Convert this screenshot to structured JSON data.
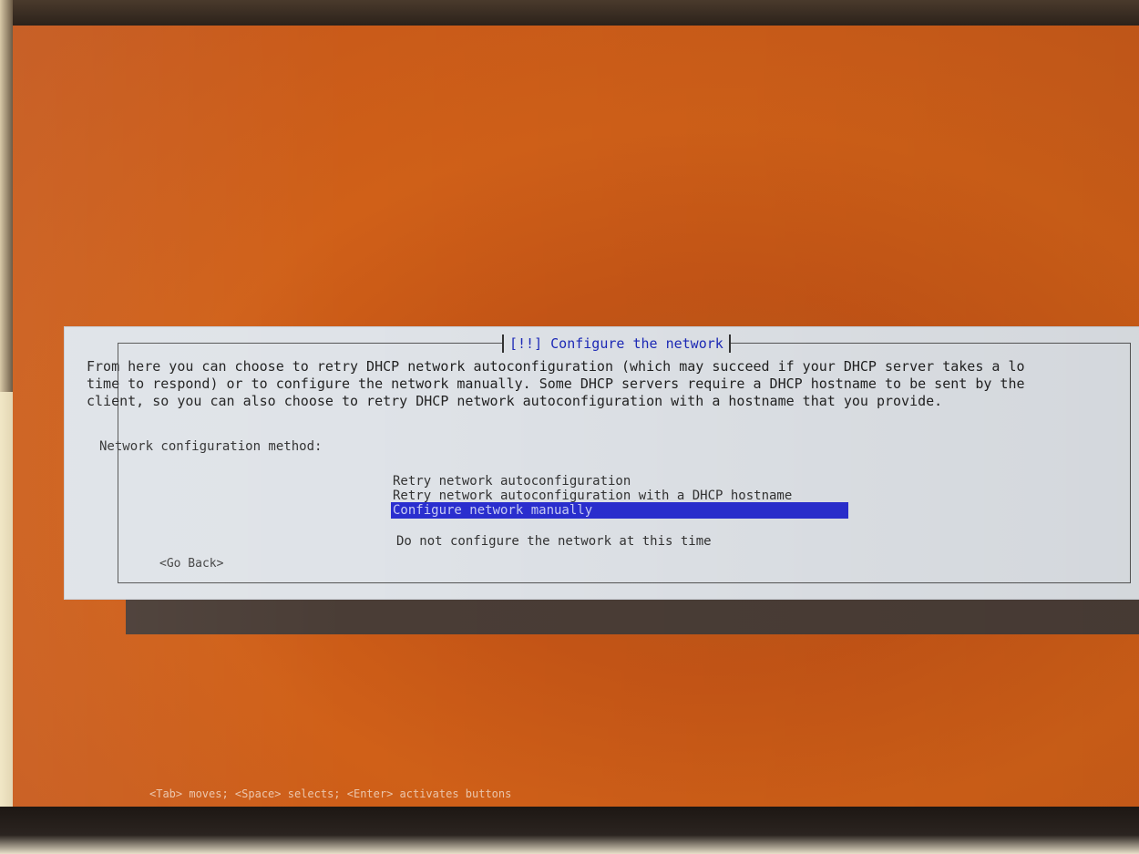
{
  "dialog": {
    "title": "[!!] Configure the network",
    "body_lines": [
      "From here you can choose to retry DHCP network autoconfiguration (which may succeed if your DHCP server takes a lo",
      "time to respond) or to configure the network manually. Some DHCP servers require a DHCP hostname to be sent by the",
      "client, so you can also choose to retry DHCP network autoconfiguration with a hostname that you provide."
    ],
    "method_label": "Network configuration method:",
    "options": [
      "Retry network autoconfiguration",
      "Retry network autoconfiguration with a DHCP hostname",
      "Configure network manually",
      "Do not configure the network at this time"
    ],
    "selected_option": "Configure network manually",
    "go_back_label": "<Go Back>"
  },
  "help_line": "<Tab> moves; <Space> selects; <Enter> activates buttons",
  "colors": {
    "background": "#c55516",
    "dialog": "#dfe3e8",
    "title": "#1d2ab8",
    "selection": "#2a2ed0"
  }
}
